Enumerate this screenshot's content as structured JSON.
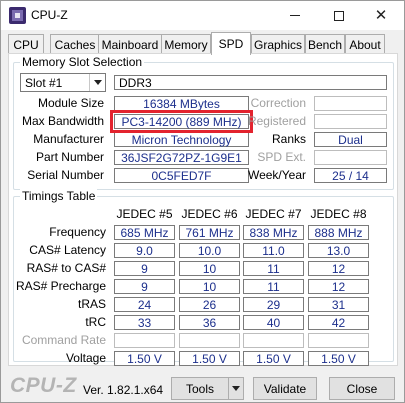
{
  "window": {
    "title": "CPU-Z"
  },
  "tabs": [
    "CPU",
    "Caches",
    "Mainboard",
    "Memory",
    "SPD",
    "Graphics",
    "Bench",
    "About"
  ],
  "slot_group": {
    "legend": "Memory Slot Selection",
    "slot_select": "Slot #1",
    "memory_type": "DDR3",
    "labels": {
      "module_size": "Module Size",
      "max_bandwidth": "Max Bandwidth",
      "manufacturer": "Manufacturer",
      "part_number": "Part Number",
      "serial_number": "Serial Number",
      "correction": "Correction",
      "registered": "Registered",
      "ranks": "Ranks",
      "spd_ext": "SPD Ext.",
      "week_year": "Week/Year"
    },
    "values": {
      "module_size": "16384 MBytes",
      "max_bandwidth": "PC3-14200 (889 MHz)",
      "manufacturer": "Micron Technology",
      "part_number": "36JSF2G72PZ-1G9E1",
      "serial_number": "0C5FED7F",
      "correction": "",
      "registered": "",
      "ranks": "Dual",
      "spd_ext": "",
      "week_year": "25 / 14"
    },
    "highlight_color": "#e3232e"
  },
  "timings": {
    "legend": "Timings Table",
    "columns": [
      "JEDEC #5",
      "JEDEC #6",
      "JEDEC #7",
      "JEDEC #8"
    ],
    "rows": [
      {
        "label": "Frequency",
        "values": [
          "685 MHz",
          "761 MHz",
          "838 MHz",
          "888 MHz"
        ]
      },
      {
        "label": "CAS# Latency",
        "values": [
          "9.0",
          "10.0",
          "11.0",
          "13.0"
        ]
      },
      {
        "label": "RAS# to CAS#",
        "values": [
          "9",
          "10",
          "11",
          "12"
        ]
      },
      {
        "label": "RAS# Precharge",
        "values": [
          "9",
          "10",
          "11",
          "12"
        ]
      },
      {
        "label": "tRAS",
        "values": [
          "24",
          "26",
          "29",
          "31"
        ]
      },
      {
        "label": "tRC",
        "values": [
          "33",
          "36",
          "40",
          "42"
        ]
      },
      {
        "label": "Command Rate",
        "values": [
          "",
          "",
          "",
          ""
        ]
      },
      {
        "label": "Voltage",
        "values": [
          "1.50 V",
          "1.50 V",
          "1.50 V",
          "1.50 V"
        ]
      }
    ]
  },
  "footer": {
    "logo": "CPU-Z",
    "version": "Ver. 1.82.1.x64",
    "tools_label": "Tools",
    "validate_label": "Validate",
    "close_label": "Close"
  }
}
